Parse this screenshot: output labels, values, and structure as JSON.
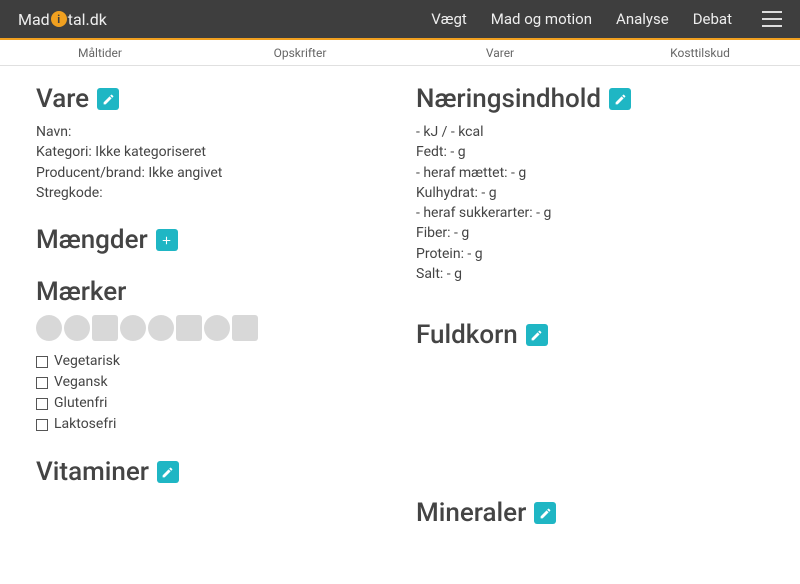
{
  "brand": {
    "pre": "Mad",
    "post": "tal.dk"
  },
  "nav": {
    "items": [
      "Vægt",
      "Mad og motion",
      "Analyse",
      "Debat"
    ]
  },
  "subnav": {
    "items": [
      "Måltider",
      "Opskrifter",
      "Varer",
      "Kosttilskud"
    ]
  },
  "left": {
    "vare": {
      "title": "Vare",
      "navn": "Navn:",
      "kategori": "Kategori: Ikke kategoriseret",
      "producent": "Producent/brand: Ikke angivet",
      "stregkode": "Stregkode:"
    },
    "maengder": {
      "title": "Mængder"
    },
    "maerker": {
      "title": "Mærker",
      "checks": [
        "Vegetarisk",
        "Vegansk",
        "Glutenfri",
        "Laktosefri"
      ]
    },
    "vitaminer": {
      "title": "Vitaminer"
    }
  },
  "right": {
    "naering": {
      "title": "Næringsindhold",
      "lines": [
        "- kJ / - kcal",
        "Fedt: - g",
        "- heraf mættet: - g",
        "Kulhydrat: - g",
        "- heraf sukkerarter: - g",
        "Fiber: - g",
        "Protein: - g",
        "Salt: - g"
      ]
    },
    "fuldkorn": {
      "title": "Fuldkorn"
    },
    "mineraler": {
      "title": "Mineraler"
    }
  }
}
